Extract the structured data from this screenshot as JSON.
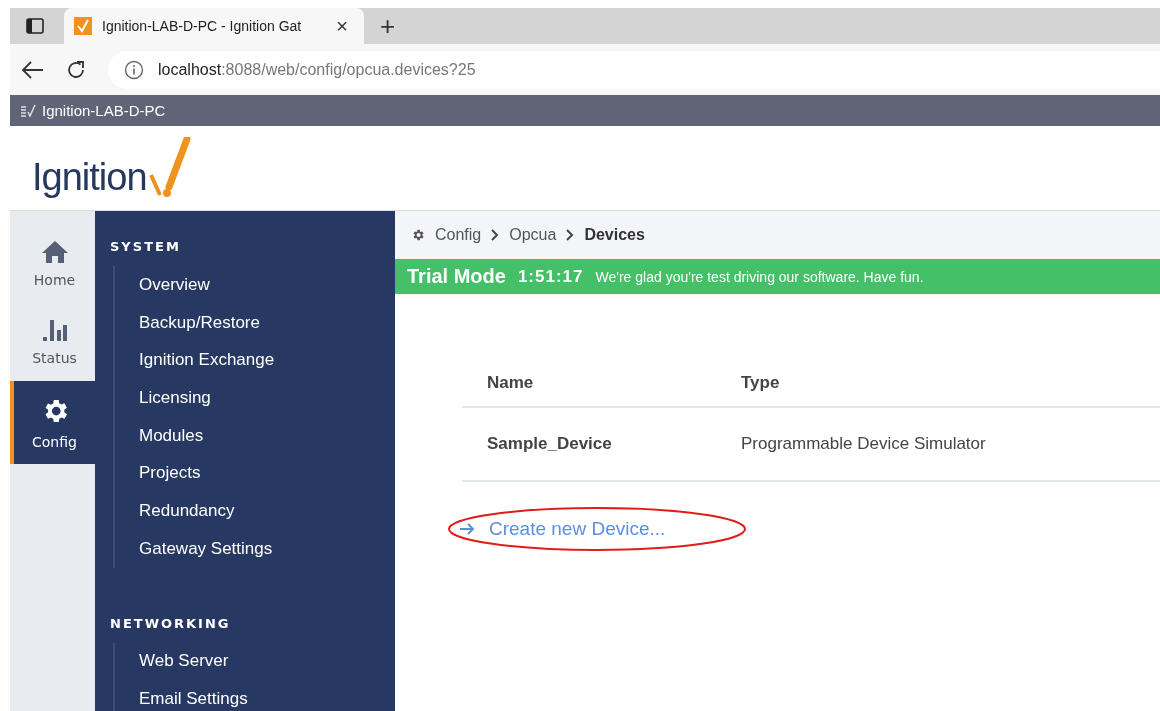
{
  "browser": {
    "tab": {
      "title": "Ignition-LAB-D-PC - Ignition Gat",
      "close": "×",
      "new_tab": "+"
    },
    "address": {
      "host": "localhost",
      "path": ":8088/web/config/opcua.devices?25"
    }
  },
  "gateway_bar": {
    "title": "Ignition-LAB-D-PC"
  },
  "logo": {
    "text": "Ignition"
  },
  "rail": [
    {
      "label": "Home",
      "selected": false
    },
    {
      "label": "Status",
      "selected": false
    },
    {
      "label": "Config",
      "selected": true
    }
  ],
  "nav": [
    {
      "heading": "SYSTEM",
      "items": [
        "Overview",
        "Backup/Restore",
        "Ignition Exchange",
        "Licensing",
        "Modules",
        "Projects",
        "Redundancy",
        "Gateway Settings"
      ]
    },
    {
      "heading": "NETWORKING",
      "items": [
        "Web Server",
        "Email Settings"
      ]
    }
  ],
  "breadcrumb": [
    "Config",
    "Opcua",
    "Devices"
  ],
  "trial": {
    "title": "Trial Mode",
    "time": "1:51:17",
    "message": "We're glad you're test driving our software. Have fun."
  },
  "table": {
    "columns": [
      "Name",
      "Type"
    ],
    "rows": [
      [
        "Sample_Device",
        "Programmable Device Simulator"
      ]
    ]
  },
  "create_link": {
    "label": "Create new Device..."
  }
}
